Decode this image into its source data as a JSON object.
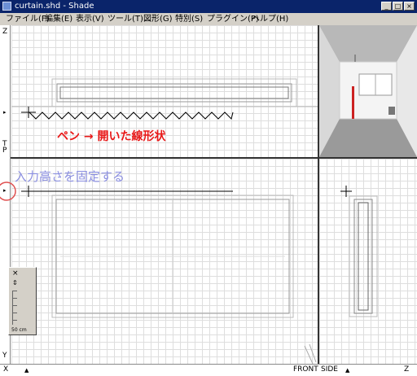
{
  "window": {
    "title": "curtain.shd - Shade"
  },
  "menu": [
    "ファイル(F)",
    "編集(E)",
    "表示(V)",
    "ツール(T)",
    "図形(G)",
    "特別(S)",
    "プラグイン(P)",
    "ヘルプ(H)"
  ],
  "annotations": {
    "pen_caption": "ペン → 開いた線形状",
    "input_height_caption": "入力高さを固定する"
  },
  "rulers": {
    "top_left_z": "Z",
    "left_t": "T",
    "left_p": "P",
    "bottom_y": "Y",
    "bottom_x": "X",
    "bottom_z": "Z"
  },
  "view_labels": {
    "front": "FRONT",
    "side": "SIDE"
  },
  "tool_palette": {
    "scale_label": "50 cm"
  },
  "colors": {
    "titlebar": "#0a246a",
    "pen_caption": "#e81818",
    "input_caption": "#8a8ee0",
    "highlight_circle": "#e05050"
  }
}
